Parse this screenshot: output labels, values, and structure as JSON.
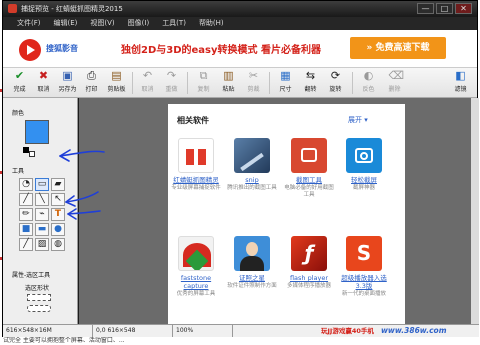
{
  "window": {
    "title": "捕捉预览 - 红蜻蜓抓图精灵2015",
    "buttons": [
      "—",
      "□",
      "✕"
    ]
  },
  "menu": [
    "文件(F)",
    "编辑(E)",
    "视图(V)",
    "图像(I)",
    "工具(T)",
    "帮助(H)"
  ],
  "ad": {
    "brand": "搜狐影音",
    "slogan": "独创2D与3D的easy转换模式  看片必备利器",
    "button": "» 免费高速下载"
  },
  "toolbar": [
    {
      "label": "完成",
      "icon": "✔"
    },
    {
      "label": "取消",
      "icon": "✖"
    },
    {
      "label": "另存为",
      "icon": "▣"
    },
    {
      "label": "打印",
      "icon": "⎙"
    },
    {
      "label": "剪贴板",
      "icon": "▤"
    },
    {
      "label": "取消",
      "icon": "↶"
    },
    {
      "label": "重做",
      "icon": "↷"
    },
    {
      "label": "复制",
      "icon": "⧉"
    },
    {
      "label": "粘贴",
      "icon": "▥"
    },
    {
      "label": "剪裁",
      "icon": "✂"
    },
    {
      "label": "尺寸",
      "icon": "▦"
    },
    {
      "label": "翻转",
      "icon": "⇆"
    },
    {
      "label": "旋转",
      "icon": "⟳"
    },
    {
      "label": "反色",
      "icon": "◐"
    },
    {
      "label": "删除",
      "icon": "⌫"
    },
    {
      "label": "滤镜",
      "icon": "◧"
    }
  ],
  "left_panel": {
    "color_label": "颜色",
    "tools_label": "工具",
    "props_label": "属性-选区工具",
    "shape_label": "选区形状",
    "tools": [
      "◔",
      "▭",
      "▰",
      "╱",
      "╲",
      "↖",
      "✏",
      "⌁",
      "T",
      "■",
      "▬",
      "●",
      "╱",
      "▨",
      "◍"
    ]
  },
  "panel": {
    "title": "相关软件",
    "link": "展开 ▾",
    "apps": [
      {
        "name": "红蜻蜓抓图精灵",
        "desc": "专业级屏幕捕捉软件"
      },
      {
        "name": "snip",
        "desc": "腾讯推出的截图工具"
      },
      {
        "name": "截图工具",
        "desc": "电脑必备的好用截图工具"
      },
      {
        "name": "轻松截屏",
        "desc": "截屏神器"
      },
      {
        "name": "faststone capture",
        "desc": "优秀的屏幕工具"
      },
      {
        "name": "证照之星",
        "desc": "软件证件照制作方面"
      },
      {
        "name": "flash player",
        "desc": "多媒体程序播放器"
      },
      {
        "name": "超级播放器入选3.3版",
        "desc": "新一代的桌面播放"
      }
    ]
  },
  "status": {
    "size": "616×548×16M",
    "coords": "0,0 616×548",
    "zoom": "100%",
    "ad": "玩JJ游戏赢40手机",
    "logo": "www.386w.com"
  },
  "bottom_text": "试完全 主要可以拥抱整个屏幕、活动窗口、..."
}
